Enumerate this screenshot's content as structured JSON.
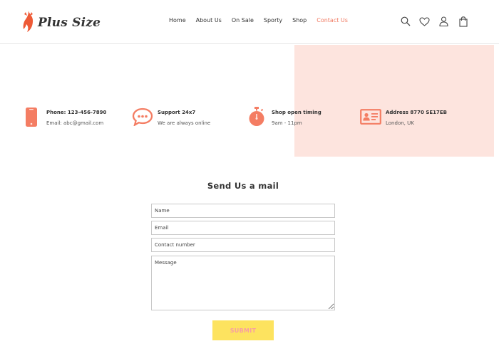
{
  "brand": {
    "name": "Plus Size",
    "accent": "#f07a62"
  },
  "nav": {
    "items": [
      {
        "label": "Home"
      },
      {
        "label": "About Us"
      },
      {
        "label": "On Sale"
      },
      {
        "label": "Sporty"
      },
      {
        "label": "Shop"
      },
      {
        "label": "Contact Us"
      }
    ],
    "active": "Contact Us"
  },
  "header_icons": [
    "search-icon",
    "heart-icon",
    "user-icon",
    "shopping-bag-icon"
  ],
  "info": [
    {
      "icon": "phone-icon",
      "title": "Phone: 123-456-7890",
      "sub": "Email: abc@gmail.com"
    },
    {
      "icon": "chat-icon",
      "title": "Support 24x7",
      "sub": "We are always online"
    },
    {
      "icon": "stopwatch-icon",
      "title": "Shop open timing",
      "sub": "9am - 11pm"
    },
    {
      "icon": "id-card-icon",
      "title": "Address 8770 SE17EB",
      "sub": "London, UK"
    }
  ],
  "form": {
    "title": "Send Us a mail",
    "name_placeholder": "Name",
    "email_placeholder": "Email",
    "contact_placeholder": "Contact number",
    "message_placeholder": "Message",
    "submit_label": "SUBMIT"
  },
  "colors": {
    "pink_block": "#fde4de",
    "submit_bg": "#fde35f",
    "submit_text": "#f79da3"
  }
}
